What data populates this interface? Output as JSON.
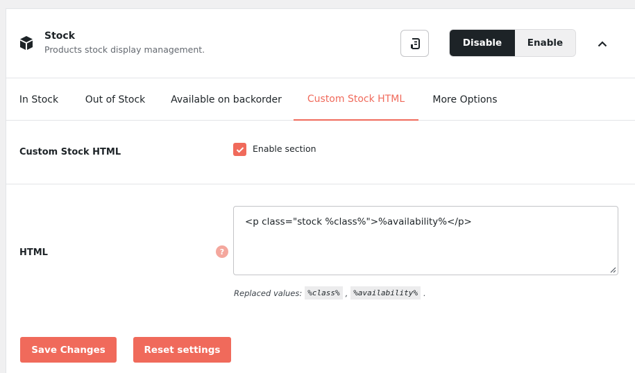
{
  "module": {
    "title": "Stock",
    "description": "Products stock display management.",
    "icon": "cube-icon"
  },
  "header": {
    "doc_icon": "document-icon",
    "disable_label": "Disable",
    "enable_label": "Enable",
    "collapse_icon": "chevron-up-icon"
  },
  "tabs": [
    {
      "label": "In Stock",
      "active": false
    },
    {
      "label": "Out of Stock",
      "active": false
    },
    {
      "label": "Available on backorder",
      "active": false
    },
    {
      "label": "Custom Stock HTML",
      "active": true
    },
    {
      "label": "More Options",
      "active": false
    }
  ],
  "section": {
    "label": "Custom Stock HTML",
    "checkbox_label": "Enable section",
    "checked": true
  },
  "html_field": {
    "label": "HTML",
    "help": "?",
    "value": "<p class=\"stock %class%\">%availability%</p>",
    "replaced_prefix": "Replaced values:",
    "values": [
      "%class%",
      "%availability%"
    ],
    "sep": ",",
    "end": "."
  },
  "actions": {
    "save": "Save Changes",
    "reset": "Reset settings"
  },
  "colors": {
    "accent": "#f06a5b",
    "dark": "#1d2327"
  }
}
